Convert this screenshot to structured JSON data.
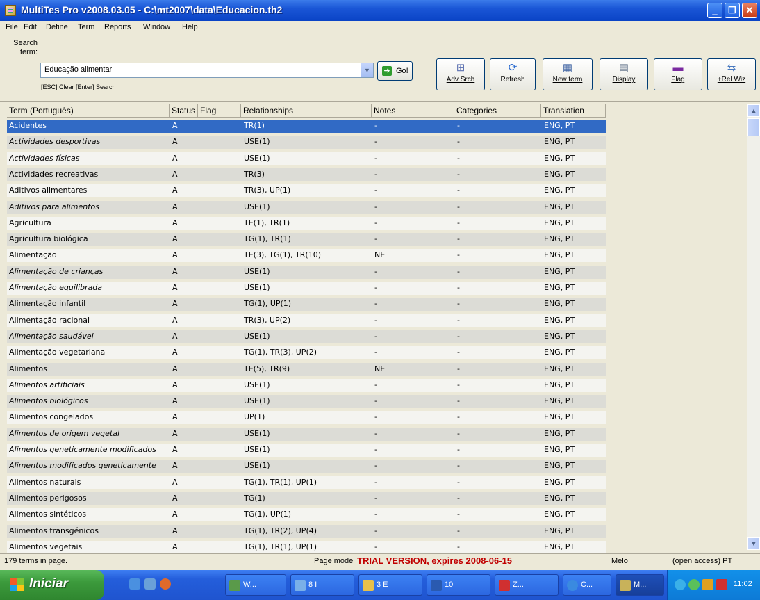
{
  "window": {
    "title": "MultiTes Pro v2008.03.05 - C:\\mt2007\\data\\Educacion.th2"
  },
  "menu": [
    "File",
    "Edit",
    "Define",
    "Term",
    "Reports",
    "Window",
    "Help"
  ],
  "search": {
    "label": "Search term:",
    "value": "Educação alimentar",
    "hint": "[ESC] Clear  [Enter] Search",
    "go_label": "Go!"
  },
  "toolbar": [
    {
      "label": "Adv Srch",
      "icon": "adv-search-icon"
    },
    {
      "label": "Refresh",
      "icon": "refresh-icon"
    },
    {
      "label": "New term",
      "icon": "new-term-icon"
    },
    {
      "label": "Display",
      "icon": "display-icon"
    },
    {
      "label": "Flag",
      "icon": "flag-icon"
    },
    {
      "label": "+Rel Wiz",
      "icon": "rel-wizard-icon"
    }
  ],
  "table": {
    "columns": [
      "Term (Português)",
      "Status",
      "Flag",
      "Relationships",
      "Notes",
      "Categories",
      "Translation"
    ],
    "rows": [
      {
        "term": "Acidentes",
        "status": "A",
        "flag": "",
        "rel": "TR(1)",
        "notes": "-",
        "cat": "-",
        "trans": "ENG, PT",
        "italic": false,
        "selected": true
      },
      {
        "term": "Actividades desportivas",
        "status": "A",
        "flag": "",
        "rel": "USE(1)",
        "notes": "-",
        "cat": "-",
        "trans": "ENG, PT",
        "italic": true
      },
      {
        "term": "Actividades físicas",
        "status": "A",
        "flag": "",
        "rel": "USE(1)",
        "notes": "-",
        "cat": "-",
        "trans": "ENG, PT",
        "italic": true
      },
      {
        "term": "Actividades recreativas",
        "status": "A",
        "flag": "",
        "rel": "TR(3)",
        "notes": "-",
        "cat": "-",
        "trans": "ENG, PT",
        "italic": false
      },
      {
        "term": "Aditivos alimentares",
        "status": "A",
        "flag": "",
        "rel": "TR(3), UP(1)",
        "notes": "-",
        "cat": "-",
        "trans": "ENG, PT",
        "italic": false
      },
      {
        "term": "Aditivos para alimentos",
        "status": "A",
        "flag": "",
        "rel": "USE(1)",
        "notes": "-",
        "cat": "-",
        "trans": "ENG, PT",
        "italic": true
      },
      {
        "term": "Agricultura",
        "status": "A",
        "flag": "",
        "rel": "TE(1), TR(1)",
        "notes": "-",
        "cat": "-",
        "trans": "ENG, PT",
        "italic": false
      },
      {
        "term": "Agricultura biológica",
        "status": "A",
        "flag": "",
        "rel": "TG(1), TR(1)",
        "notes": "-",
        "cat": "-",
        "trans": "ENG, PT",
        "italic": false
      },
      {
        "term": "Alimentação",
        "status": "A",
        "flag": "",
        "rel": "TE(3), TG(1), TR(10)",
        "notes": "NE",
        "cat": "-",
        "trans": "ENG, PT",
        "italic": false
      },
      {
        "term": "Alimentação de crianças",
        "status": "A",
        "flag": "",
        "rel": "USE(1)",
        "notes": "-",
        "cat": "-",
        "trans": "ENG, PT",
        "italic": true
      },
      {
        "term": "Alimentação equilibrada",
        "status": "A",
        "flag": "",
        "rel": "USE(1)",
        "notes": "-",
        "cat": "-",
        "trans": "ENG, PT",
        "italic": true
      },
      {
        "term": "Alimentação infantil",
        "status": "A",
        "flag": "",
        "rel": "TG(1), UP(1)",
        "notes": "-",
        "cat": "-",
        "trans": "ENG, PT",
        "italic": false
      },
      {
        "term": "Alimentação racional",
        "status": "A",
        "flag": "",
        "rel": "TR(3), UP(2)",
        "notes": "-",
        "cat": "-",
        "trans": "ENG, PT",
        "italic": false
      },
      {
        "term": "Alimentação saudável",
        "status": "A",
        "flag": "",
        "rel": "USE(1)",
        "notes": "-",
        "cat": "-",
        "trans": "ENG, PT",
        "italic": true
      },
      {
        "term": "Alimentação vegetariana",
        "status": "A",
        "flag": "",
        "rel": "TG(1), TR(3), UP(2)",
        "notes": "-",
        "cat": "-",
        "trans": "ENG, PT",
        "italic": false
      },
      {
        "term": "Alimentos",
        "status": "A",
        "flag": "",
        "rel": "TE(5), TR(9)",
        "notes": "NE",
        "cat": "-",
        "trans": "ENG, PT",
        "italic": false
      },
      {
        "term": "Alimentos artificiais",
        "status": "A",
        "flag": "",
        "rel": "USE(1)",
        "notes": "-",
        "cat": "-",
        "trans": "ENG, PT",
        "italic": true
      },
      {
        "term": "Alimentos biológicos",
        "status": "A",
        "flag": "",
        "rel": "USE(1)",
        "notes": "-",
        "cat": "-",
        "trans": "ENG, PT",
        "italic": true
      },
      {
        "term": "Alimentos congelados",
        "status": "A",
        "flag": "",
        "rel": "UP(1)",
        "notes": "-",
        "cat": "-",
        "trans": "ENG, PT",
        "italic": false
      },
      {
        "term": "Alimentos de origem vegetal",
        "status": "A",
        "flag": "",
        "rel": "USE(1)",
        "notes": "-",
        "cat": "-",
        "trans": "ENG, PT",
        "italic": true
      },
      {
        "term": "Alimentos geneticamente modificados",
        "status": "A",
        "flag": "",
        "rel": "USE(1)",
        "notes": "-",
        "cat": "-",
        "trans": "ENG, PT",
        "italic": true
      },
      {
        "term": "Alimentos modificados geneticamente",
        "status": "A",
        "flag": "",
        "rel": "USE(1)",
        "notes": "-",
        "cat": "-",
        "trans": "ENG, PT",
        "italic": true
      },
      {
        "term": "Alimentos naturais",
        "status": "A",
        "flag": "",
        "rel": "TG(1), TR(1), UP(1)",
        "notes": "-",
        "cat": "-",
        "trans": "ENG, PT",
        "italic": false
      },
      {
        "term": "Alimentos perigosos",
        "status": "A",
        "flag": "",
        "rel": "TG(1)",
        "notes": "-",
        "cat": "-",
        "trans": "ENG, PT",
        "italic": false
      },
      {
        "term": "Alimentos sintéticos",
        "status": "A",
        "flag": "",
        "rel": "TG(1), UP(1)",
        "notes": "-",
        "cat": "-",
        "trans": "ENG, PT",
        "italic": false
      },
      {
        "term": "Alimentos transgénicos",
        "status": "A",
        "flag": "",
        "rel": "TG(1), TR(2), UP(4)",
        "notes": "-",
        "cat": "-",
        "trans": "ENG, PT",
        "italic": false
      },
      {
        "term": "Alimentos vegetais",
        "status": "A",
        "flag": "",
        "rel": "TG(1), TR(1), UP(1)",
        "notes": "-",
        "cat": "-",
        "trans": "ENG, PT",
        "italic": false
      }
    ]
  },
  "status": {
    "count": "179 terms in page.",
    "mode": "Page mode",
    "trial": "TRIAL VERSION, expires 2008-06-15",
    "user": "Melo",
    "access": "(open access)  PT"
  },
  "taskbar": {
    "start_label": "Iniciar",
    "tasks": [
      "W...",
      "8 I",
      "3 E",
      "10",
      "Z...",
      "C...",
      "M..."
    ],
    "clock": "11:02"
  }
}
